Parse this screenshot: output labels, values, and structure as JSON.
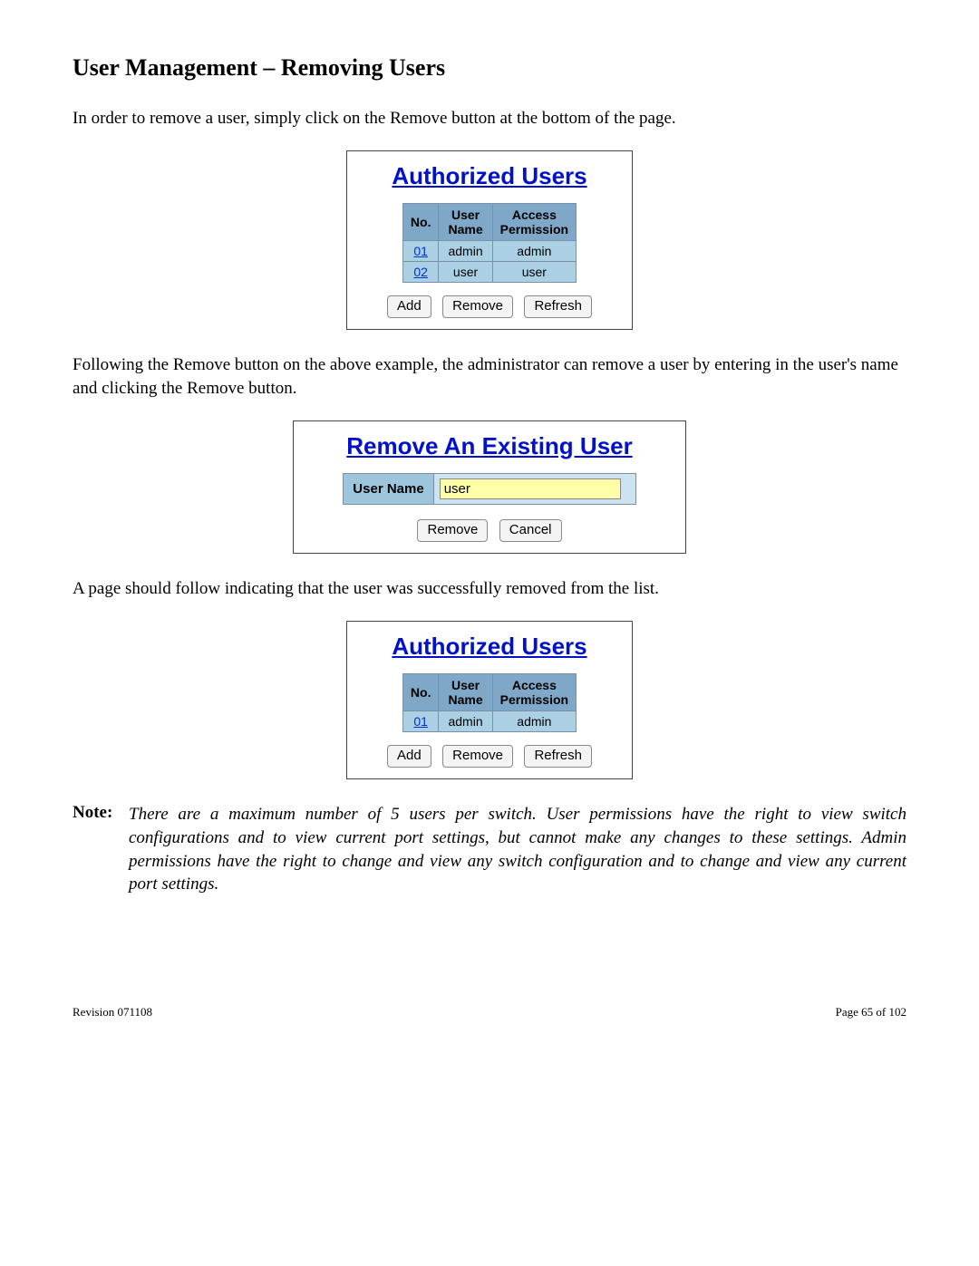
{
  "title": "User Management – Removing Users",
  "para1": "In order to remove a user, simply click on the Remove button at the bottom of the page.",
  "para2": "Following the Remove button on the above example, the administrator can remove a user by entering in the user's name and clicking the Remove button.",
  "para3": "A page should follow indicating that the user was successfully removed from the list.",
  "panel1": {
    "heading": "Authorized Users",
    "headers": {
      "no": "No.",
      "user": "User\nName",
      "access": "Access\nPermission"
    },
    "rows": [
      {
        "no": "01",
        "user": "admin",
        "access": "admin"
      },
      {
        "no": "02",
        "user": "user",
        "access": "user"
      }
    ],
    "buttons": {
      "add": "Add",
      "remove": "Remove",
      "refresh": "Refresh"
    }
  },
  "panel2": {
    "heading": "Remove An Existing User",
    "label": "User Name",
    "value": "user",
    "buttons": {
      "remove": "Remove",
      "cancel": "Cancel"
    }
  },
  "panel3": {
    "heading": "Authorized Users",
    "headers": {
      "no": "No.",
      "user": "User\nName",
      "access": "Access\nPermission"
    },
    "rows": [
      {
        "no": "01",
        "user": "admin",
        "access": "admin"
      }
    ],
    "buttons": {
      "add": "Add",
      "remove": "Remove",
      "refresh": "Refresh"
    }
  },
  "note_label": "Note:",
  "note_text": "There are a maximum number of 5 users per switch.  User permissions have the right to view switch configurations and to view current port settings, but cannot make any changes to these settings.  Admin permissions have the right to change and view any switch configuration and to change and view any current port settings.",
  "footer": {
    "rev": "Revision 071108",
    "page": "Page 65 of 102"
  }
}
